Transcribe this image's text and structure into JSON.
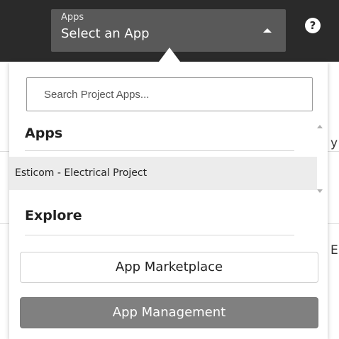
{
  "header": {
    "selector_label": "Apps",
    "selector_value": "Select an App",
    "caret_icon": "caret-up-icon",
    "help_icon": "help-icon",
    "help_glyph": "?"
  },
  "background": {
    "fragments": [
      "y",
      "EI"
    ]
  },
  "dropdown": {
    "search_placeholder": "Search Project Apps...",
    "apps_heading": "Apps",
    "apps": [
      {
        "label": "Esticom - Electrical Project"
      }
    ],
    "explore_heading": "Explore",
    "buttons": {
      "marketplace": "App Marketplace",
      "management": "App Management"
    }
  },
  "colors": {
    "topbar": "#2a2a2a",
    "selector": "#595959",
    "selected_row": "#ececec",
    "management_button": "#808080"
  }
}
